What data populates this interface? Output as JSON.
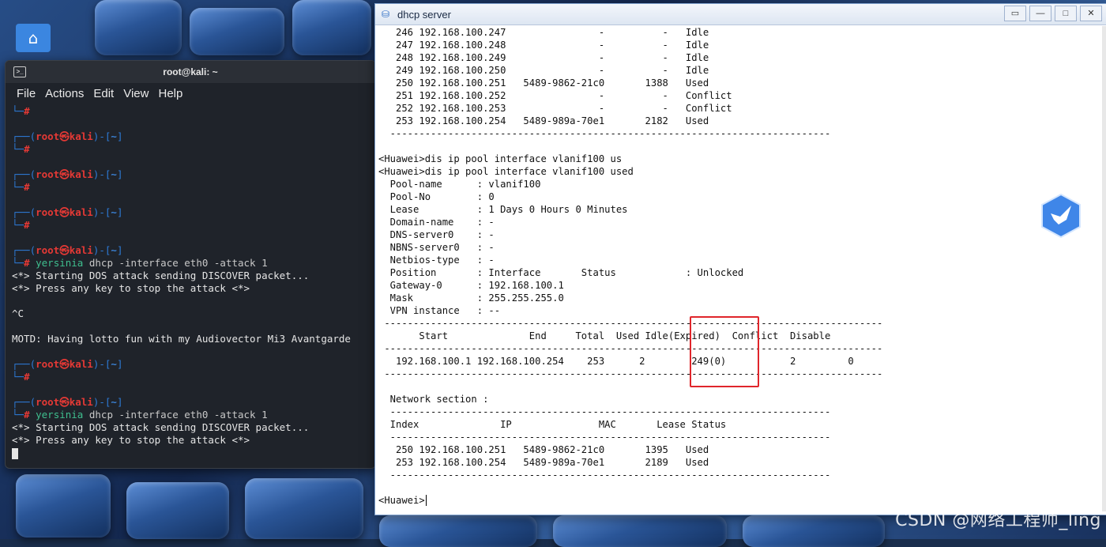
{
  "terminal": {
    "title": "root@kali: ~",
    "menu": [
      "File",
      "Actions",
      "Edit",
      "View",
      "Help"
    ],
    "prompt_user": "root",
    "prompt_at": "㉿",
    "prompt_host": "kali",
    "prompt_dir": "~",
    "command": "yersinia dhcp -interface eth0 -attack 1",
    "cmd_bin": "yersinia",
    "cmd_rest": " dhcp -interface eth0 -attack 1",
    "msg_start": "<*> Starting DOS attack sending DISCOVER packet...",
    "msg_press": "<*> Press any key to stop the attack <*>",
    "interrupt": "^C",
    "motd": "MOTD: Having lotto fun with my Audiovector Mi3 Avantgarde"
  },
  "dhcp": {
    "title": "dhcp server",
    "window_buttons": [
      "▭",
      "—",
      "□",
      "✕"
    ],
    "ip_rows": [
      {
        "idx": "246",
        "ip": "192.168.100.247",
        "mac": "-",
        "lease": "-",
        "status": "Idle"
      },
      {
        "idx": "247",
        "ip": "192.168.100.248",
        "mac": "-",
        "lease": "-",
        "status": "Idle"
      },
      {
        "idx": "248",
        "ip": "192.168.100.249",
        "mac": "-",
        "lease": "-",
        "status": "Idle"
      },
      {
        "idx": "249",
        "ip": "192.168.100.250",
        "mac": "-",
        "lease": "-",
        "status": "Idle"
      },
      {
        "idx": "250",
        "ip": "192.168.100.251",
        "mac": "5489-9862-21c0",
        "lease": "1388",
        "status": "Used"
      },
      {
        "idx": "251",
        "ip": "192.168.100.252",
        "mac": "-",
        "lease": "-",
        "status": "Conflict"
      },
      {
        "idx": "252",
        "ip": "192.168.100.253",
        "mac": "-",
        "lease": "-",
        "status": "Conflict"
      },
      {
        "idx": "253",
        "ip": "192.168.100.254",
        "mac": "5489-989a-70e1",
        "lease": "2182",
        "status": "Used"
      }
    ],
    "cmd1": "<Huawei>dis ip pool interface vlanif100 us",
    "cmd2": "<Huawei>dis ip pool interface vlanif100 used",
    "pool_fields": [
      {
        "k": "Pool-name",
        "v": "vlanif100"
      },
      {
        "k": "Pool-No",
        "v": "0"
      },
      {
        "k": "Lease",
        "v": "1 Days 0 Hours 0 Minutes"
      },
      {
        "k": "Domain-name",
        "v": "-"
      },
      {
        "k": "DNS-server0",
        "v": "-"
      },
      {
        "k": "NBNS-server0",
        "v": "-"
      },
      {
        "k": "Netbios-type",
        "v": "-"
      },
      {
        "k": "Position",
        "v": "Interface       Status            : Unlocked"
      },
      {
        "k": "Gateway-0",
        "v": "192.168.100.1"
      },
      {
        "k": "Mask",
        "v": "255.255.255.0"
      },
      {
        "k": "VPN instance",
        "v": "--"
      }
    ],
    "summary_header": [
      "Start",
      "End",
      "Total",
      "Used",
      "Idle(Expired)",
      "Conflict",
      "Disable"
    ],
    "summary_row": [
      "192.168.100.1",
      "192.168.100.254",
      "253",
      "2",
      "249(0)",
      "2",
      "0"
    ],
    "network_section_label": "Network section :",
    "net_header": [
      "Index",
      "IP",
      "MAC",
      "Lease",
      "Status"
    ],
    "net_rows": [
      {
        "idx": "250",
        "ip": "192.168.100.251",
        "mac": "5489-9862-21c0",
        "lease": "1395",
        "status": "Used"
      },
      {
        "idx": "253",
        "ip": "192.168.100.254",
        "mac": "5489-989a-70e1",
        "lease": "2189",
        "status": "Used"
      }
    ],
    "final_prompt": "<Huawei>"
  },
  "watermark": "CSDN @网络工程师_ling",
  "colors": {
    "prompt_red": "#e53935",
    "prompt_blue": "#3b82d6",
    "highlight": "#e0262b"
  }
}
